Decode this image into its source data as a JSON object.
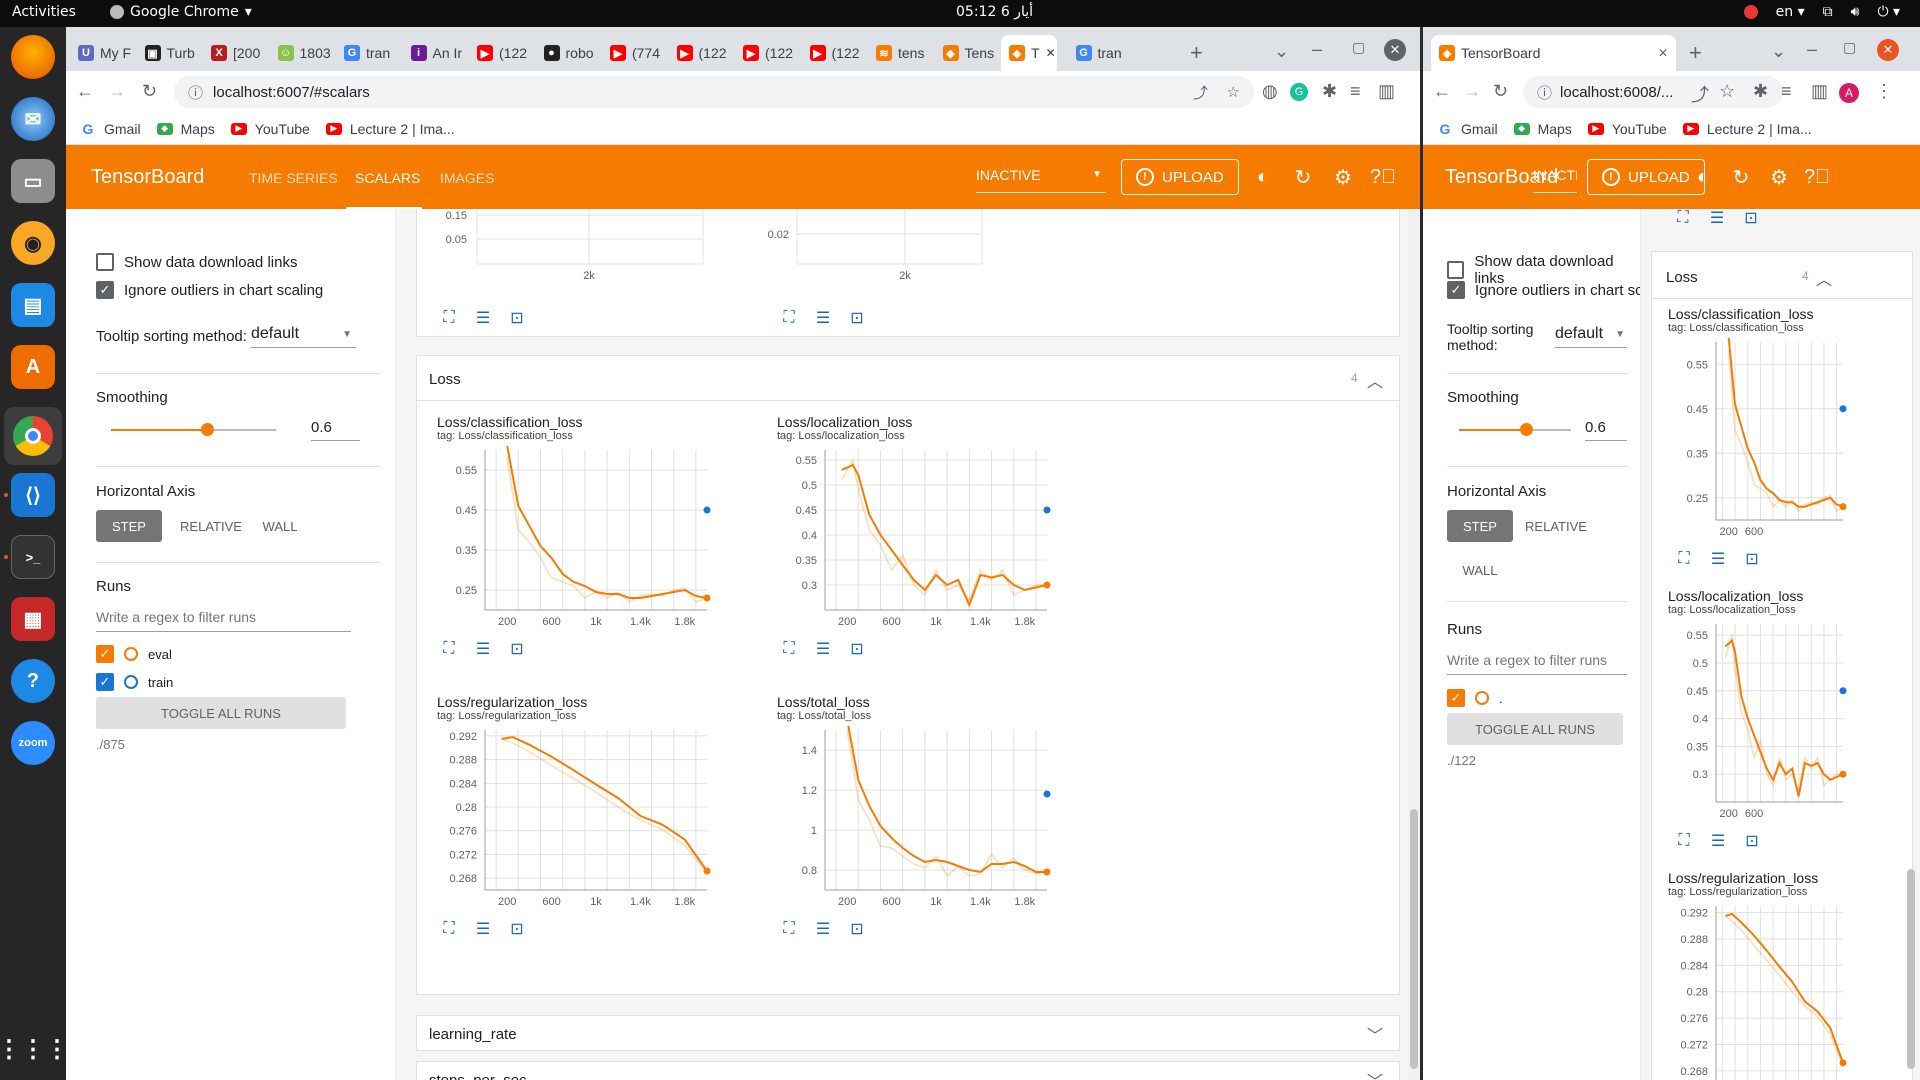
{
  "system": {
    "activities": "Activities",
    "app": "Google Chrome",
    "clock": "أيار 6  05:12",
    "lang": "en"
  },
  "dock": [
    "firefox-icon",
    "thunderbird-icon",
    "files-icon",
    "rhythmbox-icon",
    "writer-icon",
    "software-icon",
    "chrome-icon",
    "vscode-icon",
    "terminal-icon",
    "app-icon",
    "help-icon",
    "zoom-icon",
    "apps-grid-icon"
  ],
  "left_window": {
    "tabs": [
      {
        "label": "My F",
        "color": "#5c6bc0",
        "glyph": "U"
      },
      {
        "label": "Turb",
        "color": "#222",
        "glyph": "▣"
      },
      {
        "label": "[200",
        "color": "#b71c1c",
        "glyph": "X"
      },
      {
        "label": "1803",
        "color": "#8bc34a",
        "glyph": "☺"
      },
      {
        "label": "tran",
        "color": "#4285f4",
        "glyph": "G"
      },
      {
        "label": "An Ir",
        "color": "#6a1b9a",
        "glyph": "i"
      },
      {
        "label": "(122",
        "color": "#ff0000",
        "glyph": "▶"
      },
      {
        "label": "robo",
        "color": "#222",
        "glyph": "●"
      },
      {
        "label": "(774",
        "color": "#ff0000",
        "glyph": "▶"
      },
      {
        "label": "(122",
        "color": "#ff0000",
        "glyph": "▶"
      },
      {
        "label": "(122",
        "color": "#ff0000",
        "glyph": "▶"
      },
      {
        "label": "(122",
        "color": "#ff0000",
        "glyph": "▶"
      },
      {
        "label": "tens",
        "color": "#f57c00",
        "glyph": "≋"
      },
      {
        "label": "Tens",
        "color": "#f57c00",
        "glyph": "◈"
      },
      {
        "label": "T",
        "color": "#f57c00",
        "glyph": "◈"
      },
      {
        "label": "tran",
        "color": "#4285f4",
        "glyph": "G"
      }
    ],
    "url": "localhost:6007/#scalars",
    "bookmarks": [
      {
        "label": "Gmail",
        "icon": "google-icon"
      },
      {
        "label": "Maps",
        "icon": "maps-icon"
      },
      {
        "label": "YouTube",
        "icon": "youtube-icon"
      },
      {
        "label": "Lecture 2 | Ima...",
        "icon": "youtube-icon"
      }
    ],
    "header": {
      "logo": "TensorBoard",
      "nav": [
        "TIME SERIES",
        "SCALARS",
        "IMAGES"
      ],
      "active_nav": "SCALARS",
      "select": "INACTIVE",
      "upload": "UPLOAD"
    },
    "sidebar": {
      "show_download": "Show data download links",
      "ignore_outliers": "Ignore outliers in chart scaling",
      "tooltip_label": "Tooltip sorting method:",
      "tooltip_value": "default",
      "smoothing_label": "Smoothing",
      "smoothing_value": "0.6",
      "smoothing_fraction": 0.6,
      "axis_label": "Horizontal Axis",
      "axis_options": [
        "STEP",
        "RELATIVE",
        "WALL"
      ],
      "runs_label": "Runs",
      "filter_placeholder": "Write a regex to filter runs",
      "runs": [
        {
          "name": "eval",
          "color": "#f57c00"
        },
        {
          "name": "train",
          "color": "#1976d2"
        }
      ],
      "toggle_all": "TOGGLE ALL RUNS",
      "logdir": "./875"
    },
    "main": {
      "partial_top_ticks_left": [
        "0.15",
        "0.05"
      ],
      "partial_top_tick_right": "0.02",
      "partial_top_xtick": "2k",
      "loss_group": {
        "name": "Loss",
        "count": "4"
      },
      "collapsed_groups": [
        "learning_rate",
        "steps_per_sec"
      ]
    }
  },
  "right_window": {
    "tab": "TensorBoard",
    "url": "localhost:6008/...",
    "bookmarks": [
      {
        "label": "Gmail",
        "icon": "google-icon"
      },
      {
        "label": "Maps",
        "icon": "maps-icon"
      },
      {
        "label": "YouTube",
        "icon": "youtube-icon"
      },
      {
        "label": "Lecture 2 | Ima...",
        "icon": "youtube-icon"
      }
    ],
    "header": {
      "logo": "TensorBoard",
      "select": "INACTIV",
      "upload": "UPLOAD"
    },
    "sidebar": {
      "show_download": "Show data download links",
      "ignore_outliers": "Ignore outliers in chart scalin",
      "tooltip_label_1": "Tooltip sorting",
      "tooltip_label_2": "method:",
      "tooltip_value": "default",
      "smoothing_label": "Smoothing",
      "smoothing_value": "0.6",
      "smoothing_fraction": 0.6,
      "axis_label": "Horizontal Axis",
      "axis_options": [
        "STEP",
        "RELATIVE",
        "WALL"
      ],
      "runs_label": "Runs",
      "filter_placeholder": "Write a regex to filter runs",
      "run_name": ".",
      "toggle_all": "TOGGLE ALL RUNS",
      "logdir": "./122"
    },
    "main": {
      "loss_group": {
        "name": "Loss",
        "count": "4"
      }
    }
  },
  "chart_data": [
    {
      "type": "line",
      "title": "Loss/classification_loss",
      "subtitle": "tag: Loss/classification_loss",
      "xlim": [
        0,
        2000
      ],
      "ylim": [
        0.2,
        0.6
      ],
      "xticks": [
        200,
        600,
        1000,
        1400,
        1800
      ],
      "xtick_labels": [
        "200",
        "600",
        "1k",
        "1.4k",
        "1.8k"
      ],
      "yticks": [
        0.25,
        0.35,
        0.45,
        0.55
      ],
      "ytick_labels": [
        "0.25",
        "0.35",
        "0.45",
        "0.55"
      ],
      "series": [
        {
          "name": "eval",
          "color": "#f57c00",
          "x": [
            200,
            300,
            400,
            500,
            600,
            700,
            800,
            900,
            1000,
            1100,
            1200,
            1300,
            1400,
            1500,
            1600,
            1700,
            1800,
            1900,
            2000
          ],
          "y": [
            0.61,
            0.46,
            0.41,
            0.36,
            0.33,
            0.29,
            0.27,
            0.26,
            0.245,
            0.24,
            0.24,
            0.23,
            0.23,
            0.235,
            0.24,
            0.245,
            0.25,
            0.235,
            0.23
          ],
          "raw": [
            0.58,
            0.4,
            0.37,
            0.33,
            0.28,
            0.27,
            0.26,
            0.23,
            0.245,
            0.23,
            0.245,
            0.22,
            0.235,
            0.24,
            0.235,
            0.25,
            0.255,
            0.22,
            0.23
          ]
        },
        {
          "name": "train",
          "color": "#1976d2",
          "x": [
            2000
          ],
          "y": [
            0.45
          ]
        }
      ]
    },
    {
      "type": "line",
      "title": "Loss/localization_loss",
      "subtitle": "tag: Loss/localization_loss",
      "xlim": [
        0,
        2000
      ],
      "ylim": [
        0.25,
        0.57
      ],
      "xticks": [
        200,
        600,
        1000,
        1400,
        1800
      ],
      "xtick_labels": [
        "200",
        "600",
        "1k",
        "1.4k",
        "1.8k"
      ],
      "yticks": [
        0.3,
        0.35,
        0.4,
        0.45,
        0.5,
        0.55
      ],
      "ytick_labels": [
        "0.3",
        "0.35",
        "0.4",
        "0.45",
        "0.5",
        "0.55"
      ],
      "series": [
        {
          "name": "eval",
          "color": "#f57c00",
          "x": [
            150,
            250,
            300,
            400,
            500,
            600,
            700,
            800,
            900,
            1000,
            1100,
            1200,
            1300,
            1400,
            1500,
            1600,
            1700,
            1800,
            1900,
            2000
          ],
          "y": [
            0.53,
            0.54,
            0.52,
            0.44,
            0.4,
            0.37,
            0.34,
            0.31,
            0.29,
            0.32,
            0.3,
            0.31,
            0.26,
            0.32,
            0.315,
            0.32,
            0.3,
            0.29,
            0.295,
            0.3
          ],
          "raw": [
            0.51,
            0.55,
            0.49,
            0.41,
            0.38,
            0.33,
            0.36,
            0.3,
            0.28,
            0.33,
            0.29,
            0.3,
            0.27,
            0.33,
            0.31,
            0.33,
            0.28,
            0.29,
            0.3,
            0.3
          ]
        },
        {
          "name": "train",
          "color": "#1976d2",
          "x": [
            2000
          ],
          "y": [
            0.45
          ]
        }
      ]
    },
    {
      "type": "line",
      "title": "Loss/regularization_loss",
      "subtitle": "tag: Loss/regularization_loss",
      "xlim": [
        0,
        2000
      ],
      "ylim": [
        0.266,
        0.293
      ],
      "xticks": [
        200,
        600,
        1000,
        1400,
        1800
      ],
      "xtick_labels": [
        "200",
        "600",
        "1k",
        "1.4k",
        "1.8k"
      ],
      "yticks": [
        0.268,
        0.272,
        0.276,
        0.28,
        0.284,
        0.288,
        0.292
      ],
      "ytick_labels": [
        "0.268",
        "0.272",
        "0.276",
        "0.28",
        "0.284",
        "0.288",
        "0.292"
      ],
      "series": [
        {
          "name": "eval",
          "color": "#f57c00",
          "x": [
            150,
            250,
            400,
            600,
            800,
            1000,
            1200,
            1400,
            1600,
            1800,
            2000
          ],
          "y": [
            0.2915,
            0.2918,
            0.2905,
            0.2885,
            0.2862,
            0.2838,
            0.2815,
            0.2785,
            0.277,
            0.2745,
            0.2692
          ],
          "raw": [
            0.2915,
            0.2908,
            0.2893,
            0.287,
            0.2848,
            0.2825,
            0.28,
            0.2778,
            0.2762,
            0.2735,
            0.2688
          ]
        }
      ]
    },
    {
      "type": "line",
      "title": "Loss/total_loss",
      "subtitle": "tag: Loss/total_loss",
      "xlim": [
        0,
        2000
      ],
      "ylim": [
        0.7,
        1.5
      ],
      "xticks": [
        200,
        600,
        1000,
        1400,
        1800
      ],
      "xtick_labels": [
        "200",
        "600",
        "1k",
        "1.4k",
        "1.8k"
      ],
      "yticks": [
        0.8,
        1.0,
        1.2,
        1.4
      ],
      "ytick_labels": [
        "0.8",
        "1",
        "1.2",
        "1.4"
      ],
      "series": [
        {
          "name": "eval",
          "color": "#f57c00",
          "x": [
            200,
            300,
            400,
            500,
            600,
            700,
            800,
            900,
            1000,
            1100,
            1200,
            1300,
            1400,
            1500,
            1600,
            1700,
            1800,
            1900,
            2000
          ],
          "y": [
            1.55,
            1.25,
            1.12,
            1.02,
            0.96,
            0.91,
            0.87,
            0.84,
            0.85,
            0.84,
            0.82,
            0.8,
            0.79,
            0.83,
            0.83,
            0.84,
            0.82,
            0.79,
            0.79
          ],
          "raw": [
            1.5,
            1.15,
            1.05,
            0.92,
            0.91,
            0.87,
            0.83,
            0.81,
            0.87,
            0.77,
            0.82,
            0.77,
            0.78,
            0.88,
            0.81,
            0.86,
            0.8,
            0.78,
            0.79
          ]
        },
        {
          "name": "train",
          "color": "#1976d2",
          "x": [
            2000
          ],
          "y": [
            1.18
          ]
        }
      ]
    }
  ],
  "right_chart_titles": [
    {
      "title": "Loss/classification_loss",
      "subtitle": "tag: Loss/classification_loss",
      "yticks": [
        "0.55",
        "0.45",
        "0.35",
        "0.25"
      ],
      "xticks": [
        "200",
        "600"
      ]
    },
    {
      "title": "Loss/localization_loss",
      "subtitle": "tag: Loss/localization_loss",
      "yticks": [
        "0.55",
        "0.5",
        "0.45",
        "0.4",
        "0.35",
        "0.3"
      ],
      "xticks": [
        "200",
        "600"
      ]
    },
    {
      "title": "Loss/regularization_loss",
      "subtitle": "tag: Loss/regularization_loss",
      "yticks": [
        "0.292",
        "0.288",
        "0.284",
        "0.28",
        "0.276",
        "0.272",
        "0.268"
      ]
    }
  ]
}
